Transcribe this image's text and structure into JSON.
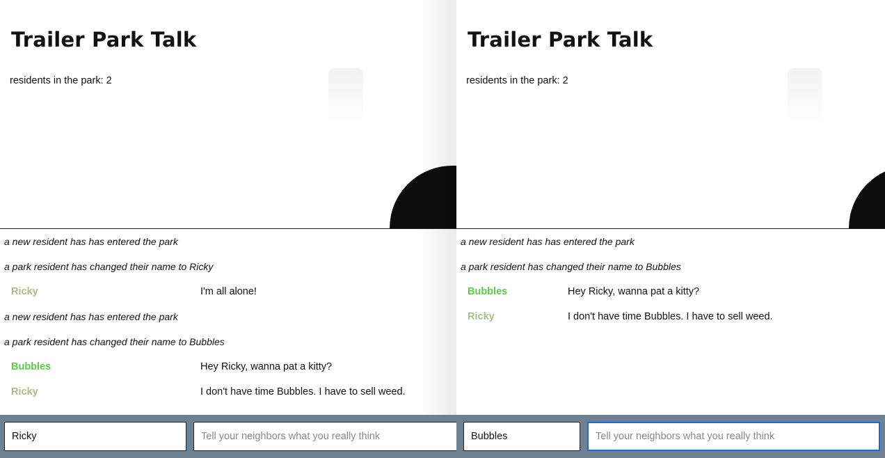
{
  "left_window": {
    "title": "Trailer Park Talk",
    "residents_text": "residents in the park: 2",
    "messages": [
      {
        "kind": "notice",
        "text": "a new resident has has entered the park"
      },
      {
        "kind": "notice",
        "text": "a park resident has changed their name to Ricky"
      },
      {
        "kind": "chat",
        "author": "Ricky",
        "text": "I'm all alone!"
      },
      {
        "kind": "notice",
        "text": "a new resident has has entered the park"
      },
      {
        "kind": "notice",
        "text": "a park resident has changed their name to Bubbles"
      },
      {
        "kind": "chat",
        "author": "Bubbles",
        "text": "Hey Ricky, wanna pat a kitty?"
      },
      {
        "kind": "chat",
        "author": "Ricky",
        "text": "I don't have time Bubbles. I have to sell weed."
      }
    ],
    "name_input": {
      "value": "Ricky"
    },
    "message_input": {
      "value": "",
      "placeholder": "Tell your neighbors what you really think"
    }
  },
  "right_window": {
    "title": "Trailer Park Talk",
    "residents_text": "residents in the park: 2",
    "messages": [
      {
        "kind": "notice",
        "text": "a new resident has has entered the park"
      },
      {
        "kind": "notice",
        "text": "a park resident has changed their name to Bubbles"
      },
      {
        "kind": "chat",
        "author": "Bubbles",
        "text": "Hey Ricky, wanna pat a kitty?"
      },
      {
        "kind": "chat",
        "author": "Ricky",
        "text": "I don't have time Bubbles. I have to sell weed."
      }
    ],
    "name_input": {
      "value": "Bubbles"
    },
    "message_input": {
      "value": "",
      "placeholder": "Tell your neighbors what you really think",
      "focused": true
    }
  },
  "colors": {
    "ricky_name": "#a9be83",
    "bubbles_name": "#5ecb46",
    "footer_bar": "#6e8190",
    "focus_ring": "#1a6fd6"
  }
}
